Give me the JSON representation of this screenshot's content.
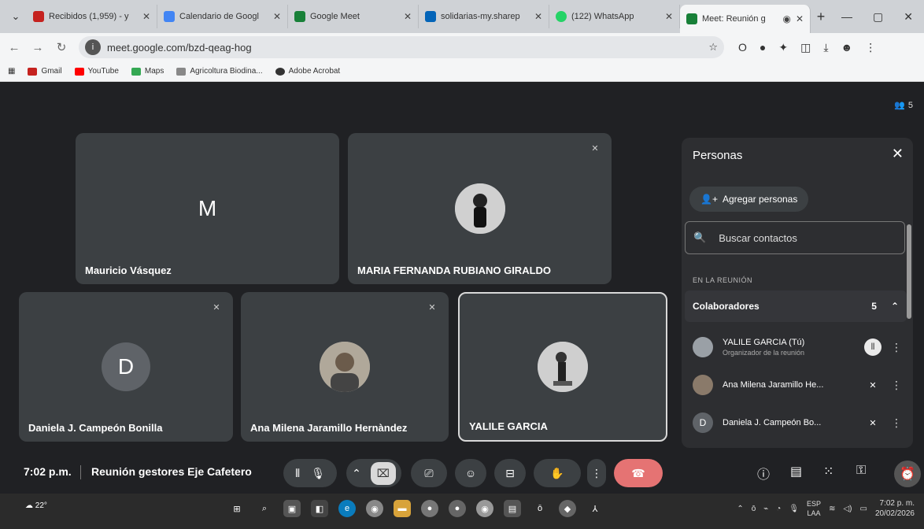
{
  "browser": {
    "tabs": [
      {
        "label": "Recibidos (1,959) - y",
        "favicon_color": "#c5221f"
      },
      {
        "label": "Calendario de Googl",
        "favicon_color": "#4285f4"
      },
      {
        "label": "Google Meet",
        "favicon_color": "#188038"
      },
      {
        "label": "solidarias-my.sharep",
        "favicon_color": "#0364b8"
      },
      {
        "label": "(122) WhatsApp",
        "favicon_color": "#25d366"
      },
      {
        "label": "Meet: Reunión g",
        "favicon_color": "#188038"
      }
    ],
    "url": "meet.google.com/bzd-qeag-hog",
    "bookmarks": [
      {
        "label": "Gmail",
        "color": "#c5221f"
      },
      {
        "label": "YouTube",
        "color": "#ff0000"
      },
      {
        "label": "Maps",
        "color": "#34a853"
      },
      {
        "label": "Agricoltura Biodina...",
        "color": "#888888"
      },
      {
        "label": "Adobe Acrobat",
        "color": "#333333"
      }
    ]
  },
  "meet": {
    "participant_count": "5",
    "tiles": [
      {
        "name": "Mauricio Vásquez",
        "letter": "M",
        "color": "#5f6368"
      },
      {
        "name": "MARIA FERNANDA RUBIANO GIRALDO"
      },
      {
        "name": "Daniela J. Campeón Bonilla",
        "letter": "D",
        "color": "#5f6368"
      },
      {
        "name": "Ana Milena Jaramillo Hernàndez"
      },
      {
        "name": "YALILE GARCIA"
      }
    ],
    "clock": "7:02 p.m.",
    "meeting_name": "Reunión gestores Eje Cafetero"
  },
  "panel": {
    "title": "Personas",
    "add_people": "Agregar personas",
    "search_placeholder": "Buscar contactos",
    "in_meeting_label": "EN LA REUNIÓN",
    "group_label": "Colaboradores",
    "group_count": "5",
    "people": [
      {
        "name": "YALILE GARCIA (Tú)",
        "role": "Organizador de la reunión"
      },
      {
        "name": "Ana Milena Jaramillo He..."
      },
      {
        "name": "Daniela J. Campeón Bo...",
        "letter": "D"
      }
    ]
  },
  "taskbar": {
    "temperature": "22°",
    "lang_top": "ESP",
    "lang_bottom": "LAA",
    "time": "7:02 p. m.",
    "date": "20/02/2026"
  }
}
